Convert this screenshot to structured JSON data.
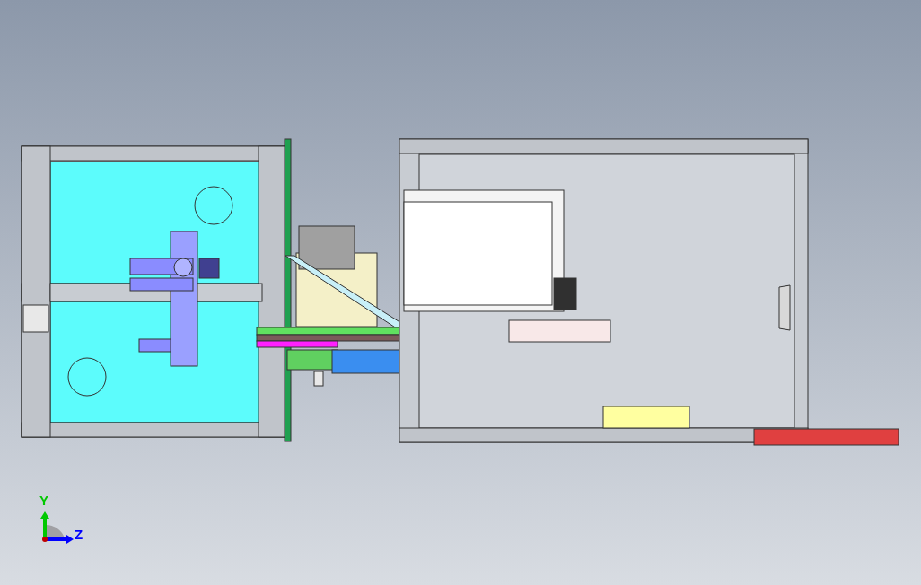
{
  "viewport": {
    "triad": {
      "axes": [
        {
          "label": "Y",
          "color": "#00c800"
        },
        {
          "label": "Z",
          "color": "#0000ff"
        }
      ]
    }
  }
}
